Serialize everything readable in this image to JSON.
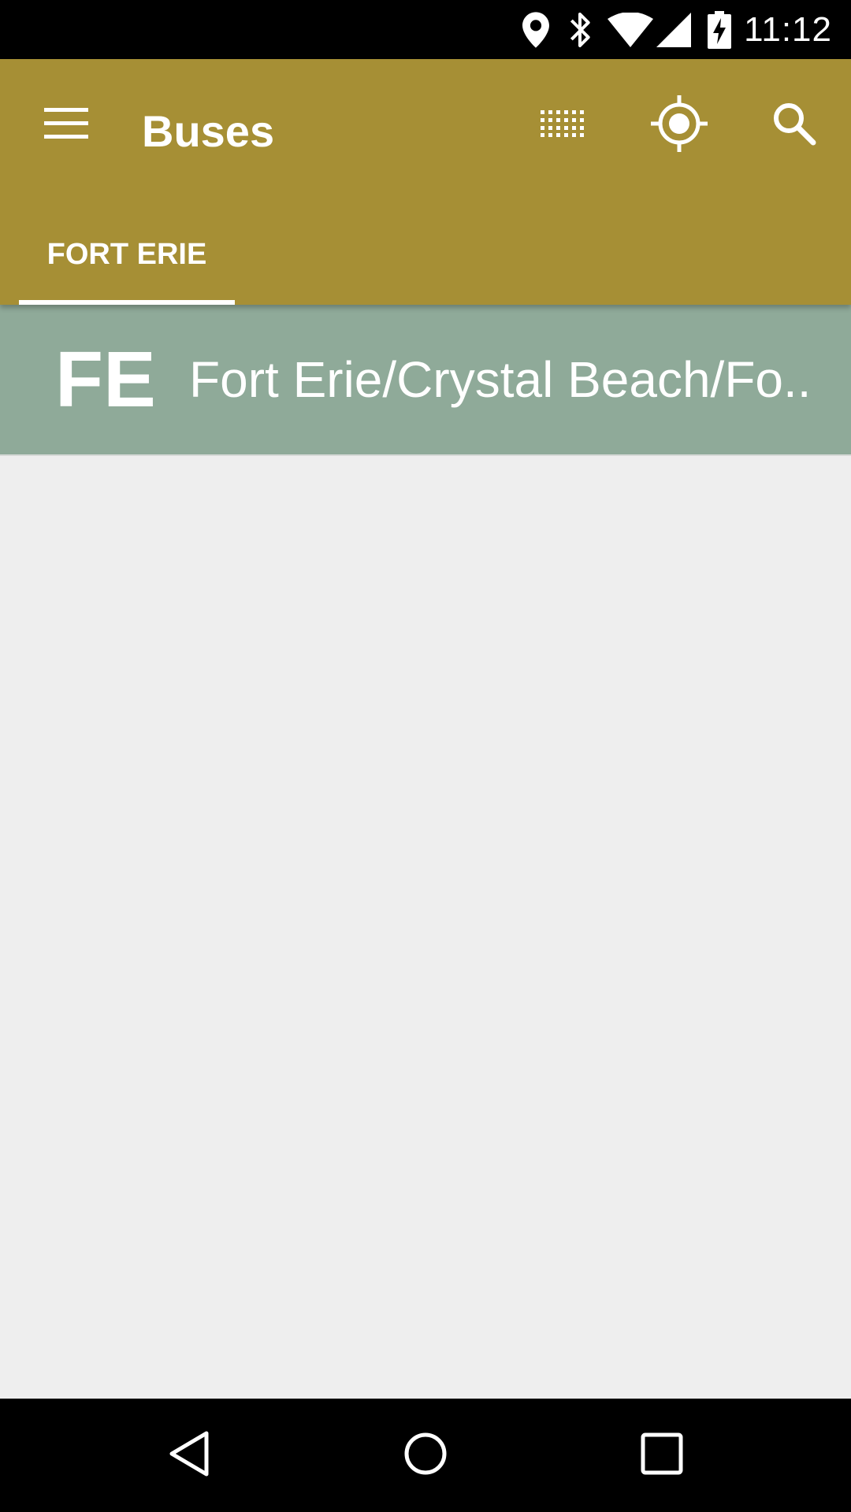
{
  "status_bar": {
    "time": "11:12",
    "icons": [
      "location-icon",
      "bluetooth-icon",
      "wifi-icon",
      "cell-signal-icon",
      "battery-charging-icon"
    ]
  },
  "app_bar": {
    "title": "Buses",
    "actions": [
      "menu-icon",
      "grid-icon",
      "my-location-icon",
      "search-icon"
    ],
    "color": "#a68f35"
  },
  "tabs": [
    {
      "label": "FORT ERIE",
      "selected": true
    }
  ],
  "routes": [
    {
      "short_name": "FE",
      "long_name": "Fort Erie/Crystal Beach/Fo..",
      "color": "#8faa99"
    }
  ],
  "nav_bar": {
    "buttons": [
      "back-icon",
      "home-icon",
      "recents-icon"
    ]
  }
}
